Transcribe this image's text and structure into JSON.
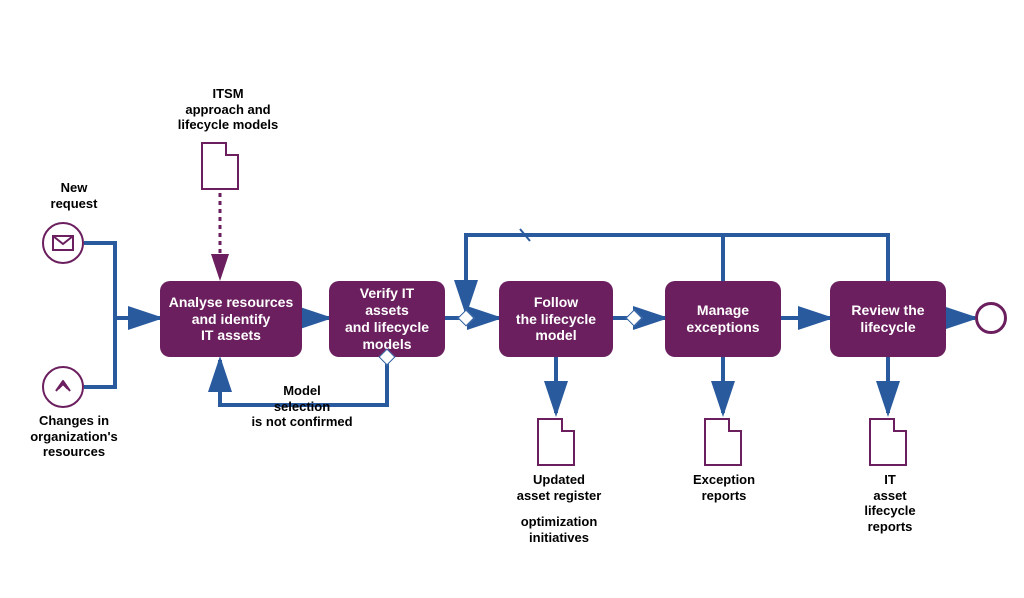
{
  "events": {
    "start1_label": "New\nrequest",
    "start2_label": "Changes in\norganization's\nresources"
  },
  "docs": {
    "top_label": "ITSM\napproach and\nlifecycle models",
    "out1_label": "Updated\nasset register",
    "out1_label2": "optimization\ninitiatives",
    "out2_label": "Exception\nreports",
    "out3_label": "IT\nasset\nlifecycle\nreports"
  },
  "tasks": {
    "t1": "Analyse resources\nand identify\nIT assets",
    "t2": "Verify IT assets\nand lifecycle\nmodels",
    "t3": "Follow\nthe lifecycle\nmodel",
    "t4": "Manage\nexceptions",
    "t5": "Review the\nlifecycle"
  },
  "labels": {
    "loop1": "Model\nselection\nis not confirmed"
  }
}
